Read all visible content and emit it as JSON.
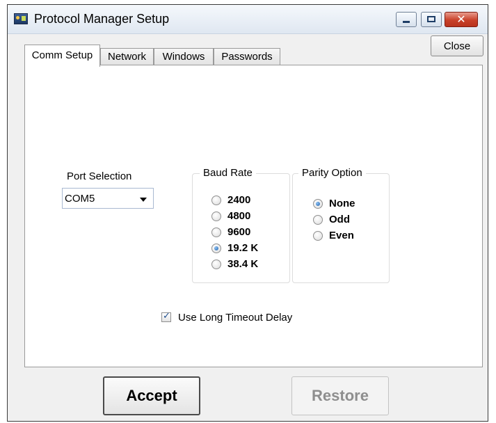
{
  "window": {
    "title": "Protocol Manager Setup"
  },
  "titlebar": {
    "minimize_icon": "minimize-icon",
    "maximize_icon": "maximize-icon",
    "close_icon": "close-x-icon",
    "close_glyph": "✕"
  },
  "toolbar": {
    "close_label": "Close"
  },
  "tabs": [
    {
      "label": "Comm Setup",
      "active": true
    },
    {
      "label": "Network",
      "active": false
    },
    {
      "label": "Windows",
      "active": false
    },
    {
      "label": "Passwords",
      "active": false
    }
  ],
  "port": {
    "label": "Port Selection",
    "selected": "COM5"
  },
  "baud": {
    "caption": "Baud Rate",
    "options": [
      "2400",
      "4800",
      "9600",
      "19.2 K",
      "38.4 K"
    ],
    "selected": "19.2 K"
  },
  "parity": {
    "caption": "Parity Option",
    "options": [
      "None",
      "Odd",
      "Even"
    ],
    "selected": "None"
  },
  "timeout": {
    "label": "Use Long Timeout Delay",
    "checked": true
  },
  "actions": {
    "accept_label": "Accept",
    "restore_label": "Restore",
    "restore_enabled": false
  },
  "colors": {
    "close_button": "#c9412a",
    "radio_selected": "#1d5ea8",
    "disabled_text": "#8e8e8e"
  }
}
